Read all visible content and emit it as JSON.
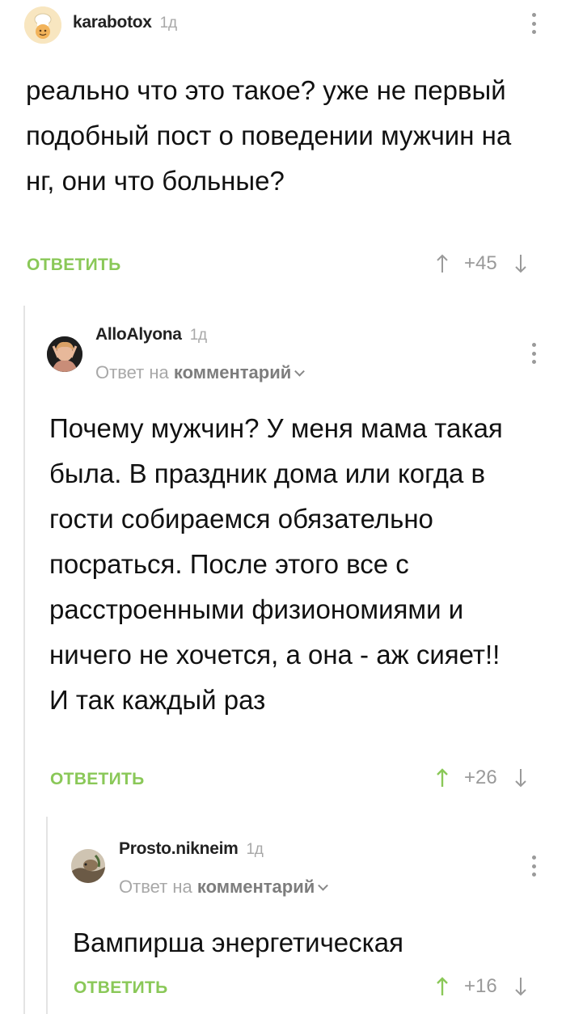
{
  "comments": [
    {
      "author": "karabotox",
      "time": "1д",
      "reply_to": null,
      "text": "реально что это такое? уже не первый подобный пост о поведении мужчин на нг, они что больные?",
      "reply_label": "ОТВЕТИТЬ",
      "rating": "+45",
      "upvoted": false
    },
    {
      "author": "AlloAlyona",
      "time": "1д",
      "reply_to": {
        "prefix": "Ответ на",
        "target": "комментарий"
      },
      "text": "Почему мужчин? У меня мама такая была. В праздник дома или когда в гости собираемся обязательно посраться. После этого все с расстроенными физиономиями и ничего не хочется, а она - аж сияет!! И так каждый раз",
      "reply_label": "ОТВЕТИТЬ",
      "rating": "+26",
      "upvoted": true
    },
    {
      "author": "Prosto.nikneim",
      "time": "1д",
      "reply_to": {
        "prefix": "Ответ на",
        "target": "комментарий"
      },
      "text": "Вампирша энергетическая",
      "reply_label": "ОТВЕТИТЬ",
      "rating": "+16",
      "upvoted": true
    }
  ],
  "colors": {
    "accent_green": "#8ac858",
    "muted_gray": "#9a9a9a",
    "thread_line": "#e4e4e4"
  },
  "icons": [
    "chef-avatar-icon",
    "user-avatar",
    "more-vertical-icon",
    "upvote-arrow-icon",
    "downvote-arrow-icon",
    "chevron-down-icon"
  ]
}
